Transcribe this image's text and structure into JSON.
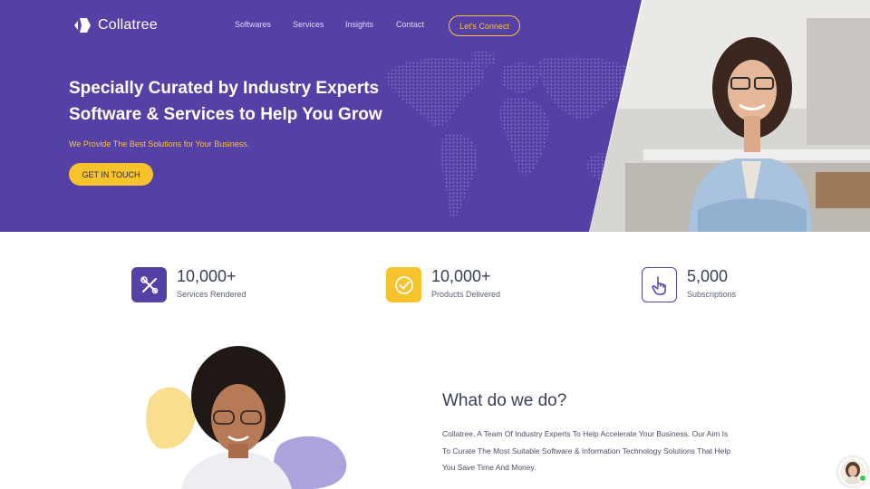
{
  "brand": {
    "name": "Collatree",
    "accent": "#f7c32d",
    "primary": "#5541a6"
  },
  "nav": {
    "items": [
      "Softwares",
      "Services",
      "Insights",
      "Contact"
    ],
    "cta_label": "Let's Connect"
  },
  "hero": {
    "title_line1": "Specially Curated by Industry Experts",
    "title_line2": "Software & Services to Help You Grow",
    "subtitle": "We Provide The Best Solutions for Your Business.",
    "button_label": "GET IN TOUCH"
  },
  "stats": [
    {
      "value": "10,000+",
      "label": "Services Rendered",
      "icon": "tools-icon",
      "color": "#5541a6"
    },
    {
      "value": "10,000+",
      "label": "Products Delivered",
      "icon": "check-circle-icon",
      "color": "#f7c32d"
    },
    {
      "value": "5,000",
      "label": "Subscriptions",
      "icon": "pointer-hand-icon",
      "color": "#5541a6"
    }
  ],
  "about": {
    "title": "What do we do?",
    "body": "Collatree, A Team Of Industry Experts To Help Accelerate Your Business. Our Aim Is To Curate The Most Suitable Software & Information Technology Solutions That Help You Save Time And Money."
  }
}
